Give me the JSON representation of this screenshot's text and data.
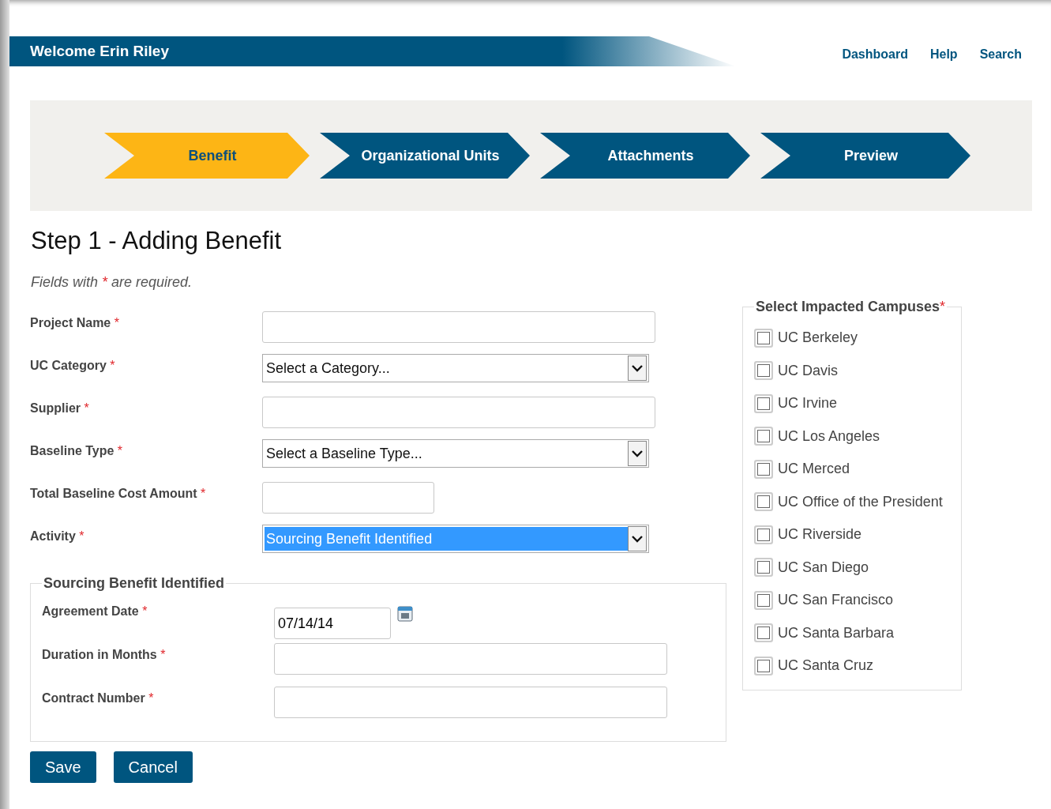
{
  "header": {
    "welcome": "Welcome Erin Riley",
    "links": [
      "Dashboard",
      "Help",
      "Search"
    ]
  },
  "steps": [
    {
      "label": "Benefit",
      "selected": true
    },
    {
      "label": "Organizational Units",
      "selected": false
    },
    {
      "label": "Attachments",
      "selected": false
    },
    {
      "label": "Preview",
      "selected": false
    }
  ],
  "title": "Step 1 - Adding Benefit",
  "note": {
    "before": "Fields with",
    "mark": "*",
    "after": "are required."
  },
  "fields": [
    {
      "label": "Project Name",
      "required_mark": "*",
      "kind": "text"
    },
    {
      "label": "UC Category",
      "required_mark": "*",
      "kind": "select",
      "value": "Select a Category...",
      "highlighted": false
    },
    {
      "label": "Supplier",
      "required_mark": "*",
      "kind": "text"
    },
    {
      "label": "Baseline Type",
      "required_mark": "*",
      "kind": "select",
      "value": "Select a Baseline Type...",
      "highlighted": false
    },
    {
      "label": "Total Baseline Cost Amount",
      "required_mark": "*",
      "kind": "amount"
    },
    {
      "label": "Activity",
      "required_mark": "*",
      "kind": "select",
      "value": "Sourcing Benefit Identified",
      "highlighted": true
    }
  ],
  "fieldset": {
    "legend": "Sourcing Benefit Identified",
    "fields": [
      {
        "label": "Agreement Date",
        "required_mark": "*",
        "kind": "date",
        "value": "07/14/14"
      },
      {
        "label": "Duration in Months",
        "required_mark": "*",
        "kind": "text"
      },
      {
        "label": "Contract Number",
        "required_mark": "*",
        "kind": "text"
      }
    ]
  },
  "campuses": {
    "legend": "Select Impacted Campuses",
    "required_mark": "*",
    "items": [
      {
        "label": "UC Berkeley",
        "checked": false
      },
      {
        "label": "UC Davis",
        "checked": false
      },
      {
        "label": "UC Irvine",
        "checked": false
      },
      {
        "label": "UC Los Angeles",
        "checked": false
      },
      {
        "label": "UC Merced",
        "checked": false
      },
      {
        "label": "UC Office of the President",
        "checked": false
      },
      {
        "label": "UC Riverside",
        "checked": false
      },
      {
        "label": "UC San Diego",
        "checked": false
      },
      {
        "label": "UC San Francisco",
        "checked": false
      },
      {
        "label": "UC Santa Barbara",
        "checked": false
      },
      {
        "label": "UC Santa Cruz",
        "checked": false
      }
    ]
  },
  "buttons": [
    "Save",
    "Cancel"
  ]
}
